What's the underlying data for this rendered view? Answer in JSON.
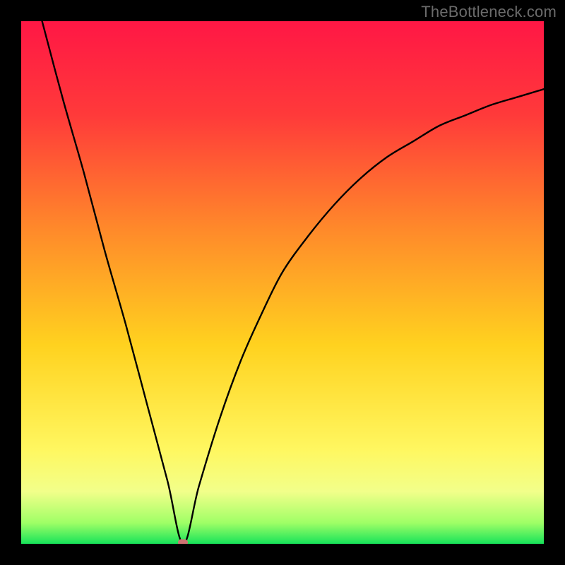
{
  "watermark": "TheBottleneck.com",
  "colors": {
    "frame": "#000000",
    "curve": "#000000",
    "marker": "#cf7373",
    "gradient_stops": [
      {
        "pct": 0,
        "color": "#ff1745"
      },
      {
        "pct": 18,
        "color": "#ff3a3a"
      },
      {
        "pct": 40,
        "color": "#ff8a2a"
      },
      {
        "pct": 62,
        "color": "#ffd21f"
      },
      {
        "pct": 82,
        "color": "#fff760"
      },
      {
        "pct": 90,
        "color": "#f2ff8a"
      },
      {
        "pct": 96,
        "color": "#9fff66"
      },
      {
        "pct": 100,
        "color": "#17e35a"
      }
    ]
  },
  "chart_data": {
    "type": "line",
    "title": "",
    "xlabel": "",
    "ylabel": "",
    "xlim": [
      0,
      100
    ],
    "ylim": [
      0,
      100
    ],
    "grid": false,
    "legend": false,
    "annotations": [
      "TheBottleneck.com"
    ],
    "marker": {
      "x": 31,
      "y": 0
    },
    "series": [
      {
        "name": "bottleneck-curve",
        "x": [
          4,
          8,
          12,
          16,
          20,
          24,
          28,
          31,
          34,
          38,
          42,
          46,
          50,
          55,
          60,
          65,
          70,
          75,
          80,
          85,
          90,
          95,
          100
        ],
        "y": [
          100,
          85,
          71,
          56,
          42,
          27,
          12,
          0,
          11,
          24,
          35,
          44,
          52,
          59,
          65,
          70,
          74,
          77,
          80,
          82,
          84,
          85.5,
          87
        ]
      }
    ]
  }
}
